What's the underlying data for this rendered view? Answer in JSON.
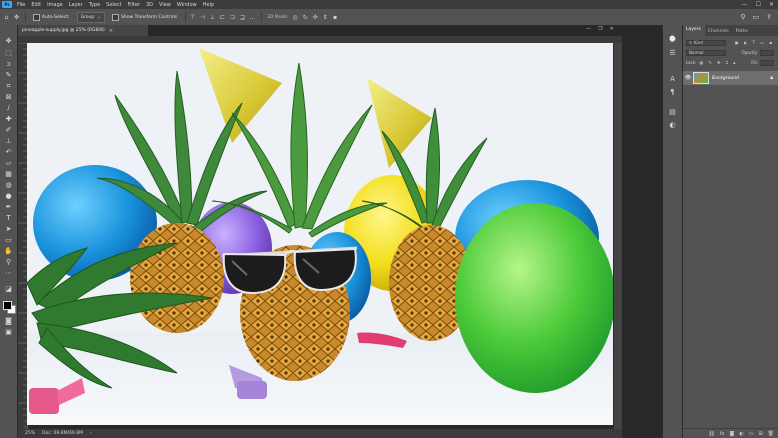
{
  "menubar": {
    "logo": "Ps",
    "items": [
      "File",
      "Edit",
      "Image",
      "Layer",
      "Type",
      "Select",
      "Filter",
      "3D",
      "View",
      "Window",
      "Help"
    ],
    "minimize": "—",
    "maximize": "☐",
    "close": "✕"
  },
  "options": {
    "auto_select_label": "Auto-Select:",
    "auto_select_value": "Group",
    "show_transform_label": "Show Transform Controls",
    "mode_label": "3D Mode:"
  },
  "document": {
    "tab_title": "pineapple-supply.jpg @ 25% (RGB/8)",
    "tab_close": "×",
    "zoom": "25%",
    "doc_size": "Doc: 69.8M/69.8M"
  },
  "layers_panel": {
    "tabs": [
      "Layers",
      "Channels",
      "Paths"
    ],
    "kind_filter": "Kind",
    "blend_mode": "Normal",
    "opacity_label": "Opacity:",
    "lock_label": "Lock:",
    "fill_label": "Fill:",
    "layer_name": "Background"
  },
  "colors": {
    "accent": "#31a8ff",
    "panel_bg": "#535353",
    "app_bg": "#282828"
  }
}
